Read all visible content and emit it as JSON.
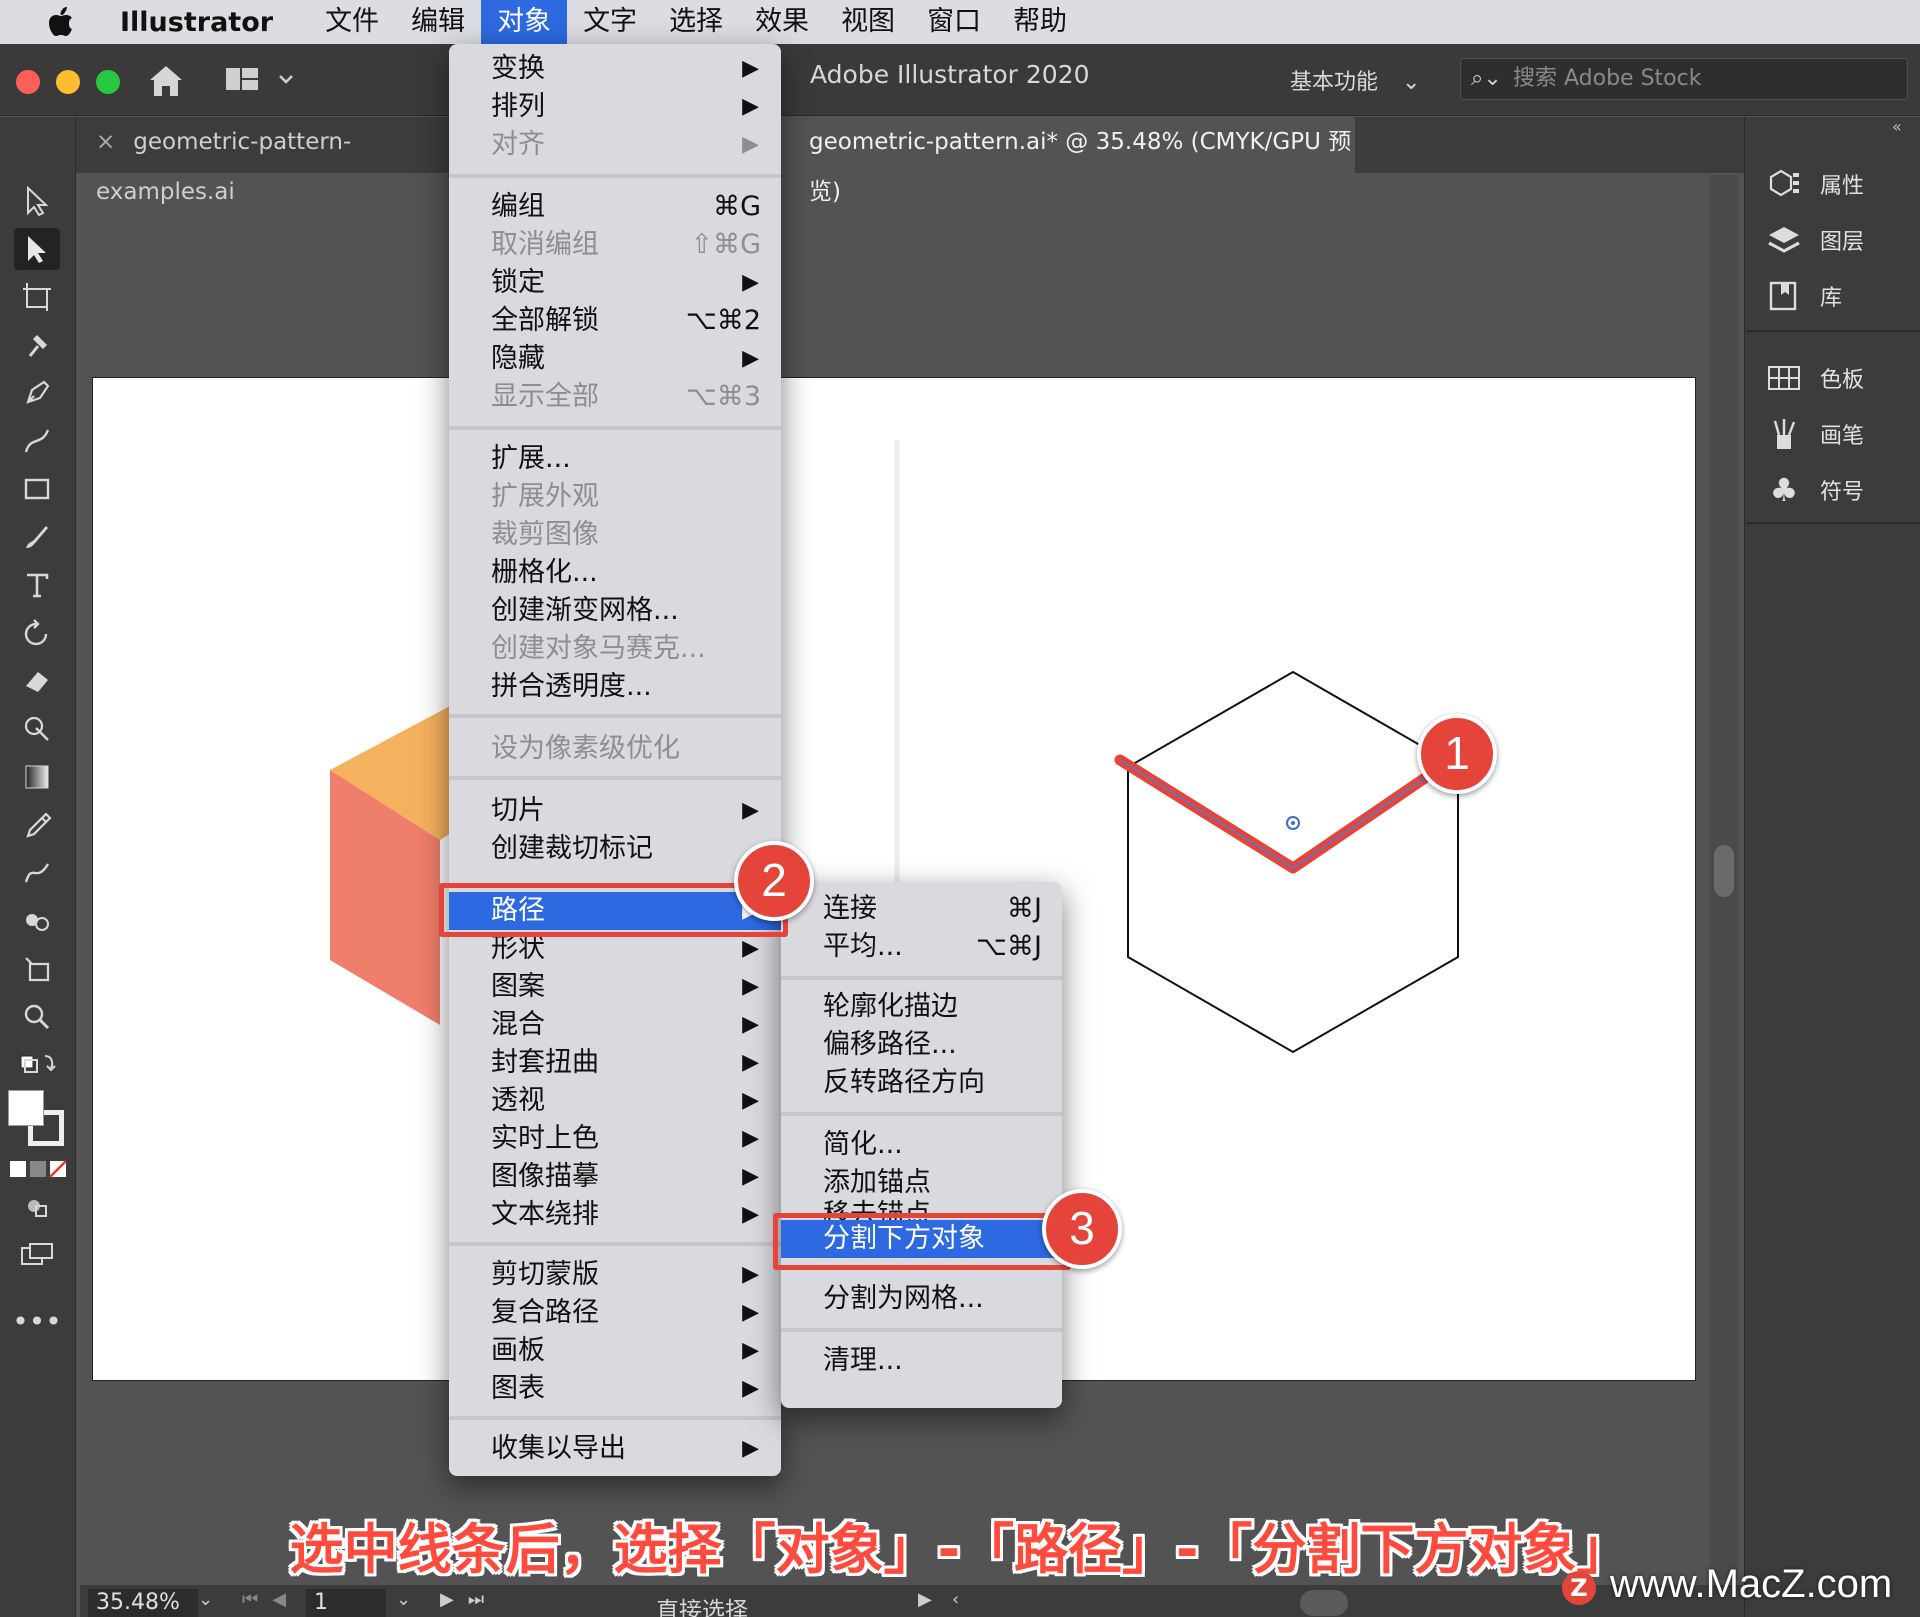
{
  "menubar": {
    "app_name": "Illustrator",
    "items": [
      "文件",
      "编辑",
      "对象",
      "文字",
      "选择",
      "效果",
      "视图",
      "窗口",
      "帮助"
    ],
    "active": "对象"
  },
  "appbar": {
    "title": "Adobe Illustrator 2020",
    "workspace": "基本功能",
    "stock_placeholder": "搜索 Adobe Stock"
  },
  "tabs": [
    {
      "label": "geometric-pattern-examples.ai",
      "active": false
    },
    {
      "label": "geometric-pattern.ai* @ 35.48% (CMYK/GPU 预览)",
      "active": true
    }
  ],
  "right_panel": {
    "group1": [
      "属性",
      "图层",
      "库"
    ],
    "group2": [
      "色板",
      "画笔",
      "符号"
    ]
  },
  "object_menu": {
    "items": [
      {
        "label": "变换",
        "submenu": true,
        "disabled": false
      },
      {
        "label": "排列",
        "submenu": true,
        "disabled": false
      },
      {
        "label": "对齐",
        "submenu": true,
        "disabled": true
      },
      {
        "label": "编组",
        "shortcut": "⌘G",
        "disabled": false
      },
      {
        "label": "取消编组",
        "shortcut": "⇧⌘G",
        "disabled": true
      },
      {
        "label": "锁定",
        "submenu": true,
        "disabled": false
      },
      {
        "label": "全部解锁",
        "shortcut": "⌥⌘2",
        "disabled": false
      },
      {
        "label": "隐藏",
        "submenu": true,
        "disabled": false
      },
      {
        "label": "显示全部",
        "shortcut": "⌥⌘3",
        "disabled": true
      },
      {
        "label": "扩展...",
        "disabled": false
      },
      {
        "label": "扩展外观",
        "disabled": true
      },
      {
        "label": "裁剪图像",
        "disabled": true
      },
      {
        "label": "栅格化...",
        "disabled": false
      },
      {
        "label": "创建渐变网格...",
        "disabled": false
      },
      {
        "label": "创建对象马赛克...",
        "disabled": true
      },
      {
        "label": "拼合透明度...",
        "disabled": false
      },
      {
        "label": "设为像素级优化",
        "disabled": true
      },
      {
        "label": "切片",
        "submenu": true,
        "disabled": false
      },
      {
        "label": "创建裁切标记",
        "disabled": false
      },
      {
        "label": "路径",
        "submenu": true,
        "highlighted": true
      },
      {
        "label": "形状",
        "submenu": true
      },
      {
        "label": "图案",
        "submenu": true
      },
      {
        "label": "混合",
        "submenu": true
      },
      {
        "label": "封套扭曲",
        "submenu": true
      },
      {
        "label": "透视",
        "submenu": true
      },
      {
        "label": "实时上色",
        "submenu": true
      },
      {
        "label": "图像描摹",
        "submenu": true
      },
      {
        "label": "文本绕排",
        "submenu": true
      },
      {
        "label": "剪切蒙版",
        "submenu": true
      },
      {
        "label": "复合路径",
        "submenu": true
      },
      {
        "label": "画板",
        "submenu": true
      },
      {
        "label": "图表",
        "submenu": true
      },
      {
        "label": "收集以导出",
        "submenu": true
      }
    ]
  },
  "path_submenu": {
    "items": [
      {
        "label": "连接",
        "shortcut": "⌘J"
      },
      {
        "label": "平均...",
        "shortcut": "⌥⌘J"
      },
      {
        "label": "轮廓化描边"
      },
      {
        "label": "偏移路径..."
      },
      {
        "label": "反转路径方向"
      },
      {
        "label": "简化..."
      },
      {
        "label": "添加锚点"
      },
      {
        "label": "移去锚点"
      },
      {
        "label": "分割下方对象",
        "highlighted": true
      },
      {
        "label": "分割为网格..."
      },
      {
        "label": "清理..."
      }
    ]
  },
  "badges": [
    "1",
    "2",
    "3"
  ],
  "caption": "选中线条后，选择「对象」-「路径」-「分割下方对象」",
  "statusbar": {
    "zoom": "35.48%",
    "artboard": "1",
    "tool": "直接选择"
  },
  "watermark": "www.MacZ.com",
  "watermark_logo": "Z",
  "colors": {
    "menu_highlight": "#2d69e0",
    "annotation_red": "#e5443b",
    "cube_orange": "#f5b15e",
    "cube_salmon": "#ef7e6a"
  }
}
